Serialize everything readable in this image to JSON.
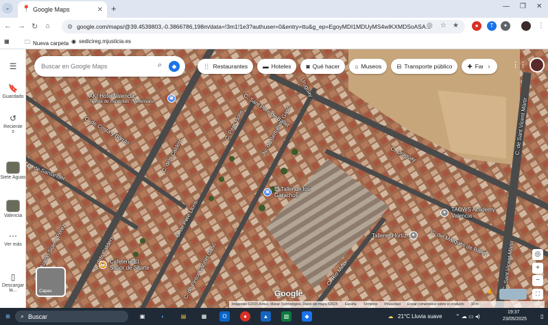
{
  "browser": {
    "tab_title": "Google Maps",
    "url": "google.com/maps/@39.4539803,-0.3866786,198m/data=!3m1!1e3?authuser=0&entry=ttu&g_ep=EgoyMDI1MDUyMS4wIKXMDSoASA...",
    "bookmarks": [
      {
        "label": "Nueva carpeta",
        "icon": "folder-icon"
      },
      {
        "label": "sedicireg.mjusticia.es",
        "icon": "globe-icon"
      }
    ]
  },
  "sidebar": {
    "items": [
      {
        "label": "Guardado",
        "icon": "bookmark-icon"
      },
      {
        "label": "Reciente s",
        "icon": "history-icon"
      },
      {
        "label": "Siete Aguas",
        "icon": "place-thumbnail"
      },
      {
        "label": "Valencia",
        "icon": "place-thumbnail"
      },
      {
        "label": "Ver más",
        "icon": "more-icon"
      },
      {
        "label": "Descargar la...",
        "icon": "phone-icon"
      }
    ]
  },
  "map": {
    "search_placeholder": "Buscar en Google Maps",
    "chips": [
      {
        "label": "Restaurantes",
        "icon": "fork-knife-icon"
      },
      {
        "label": "Hoteles",
        "icon": "bed-icon"
      },
      {
        "label": "Qué hacer",
        "icon": "camera-icon"
      },
      {
        "label": "Museos",
        "icon": "museum-icon"
      },
      {
        "label": "Transporte público",
        "icon": "transit-icon"
      },
      {
        "label": "Farma",
        "icon": "pharmacy-icon"
      }
    ],
    "streets": [
      {
        "label": "C. de Costa y Borrás"
      },
      {
        "label": "C. dels Calders"
      },
      {
        "label": "C. de Santander"
      },
      {
        "label": "C. Eduardo Soler i Pérez"
      },
      {
        "label": "C. dels Calders"
      },
      {
        "label": "C. Pere Lloris"
      },
      {
        "label": "C. Sant Pere de Ballet"
      },
      {
        "label": "C. de Pere Lloris"
      },
      {
        "label": "C. de Pintor Gabriel Gasó"
      },
      {
        "label": "Av. de Bertomeu Gasó"
      },
      {
        "label": "C. Uruguay"
      },
      {
        "label": "Uruguay"
      },
      {
        "label": "C. de Sant Vicent Màrtir"
      },
      {
        "label": "C. del Marqués de Ballet"
      },
      {
        "label": "C. Río Miño"
      },
      {
        "label": "C. Sant Vicent Màrtir"
      }
    ],
    "pois": [
      {
        "label": "AKI Hotel Valencia",
        "sub": "Tienda de mascotas · Veterinario",
        "color": "#4285f4"
      },
      {
        "label": "El Taller de los Garachos",
        "color": "#4285f4"
      },
      {
        "label": "TAOWS Academy Valencia",
        "color": "#8a8a8a"
      },
      {
        "label": "Talleres Hortiz",
        "color": "#8a8a8a"
      },
      {
        "label": "Cafetería El Sabor de Sitarte",
        "color": "#f29900"
      }
    ],
    "layers_label": "Capas",
    "logo": "Google",
    "attribution": [
      "Imágenes ©2025 Airbus, Maxar Technologies, Datos del mapa ©2025",
      "España",
      "Términos",
      "Privacidad",
      "Enviar comentarios sobre el producto",
      "10 m"
    ]
  },
  "taskbar": {
    "search_label": "Buscar",
    "weather": "21°C Lluvia suave",
    "time": "19:37",
    "date": "23/05/2025"
  }
}
